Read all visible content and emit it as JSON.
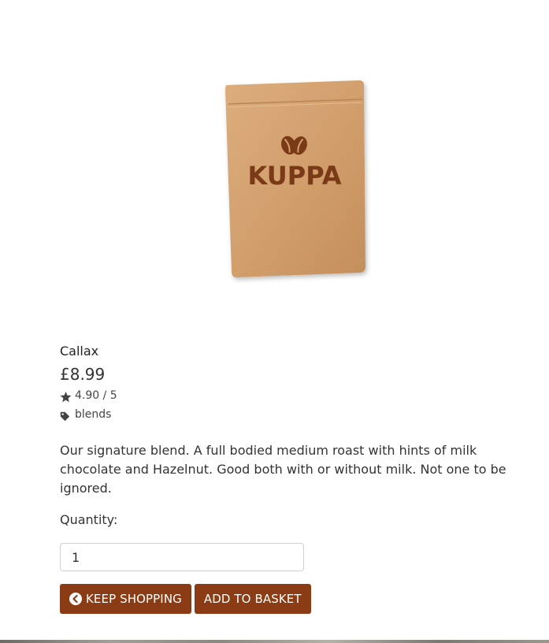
{
  "product": {
    "image_brand": "KUPPA",
    "name": "Callax",
    "price": "£8.99",
    "rating": "4.90 / 5",
    "tag": "blends",
    "description": "Our signature blend. A full bodied medium roast with hints of milk chocolate and Hazelnut. Good both with or without milk. Not one to be ignored."
  },
  "quantity": {
    "label": "Quantity:",
    "value": "1"
  },
  "buttons": {
    "keep_shopping": "KEEP SHOPPING",
    "add_to_basket": "ADD TO BASKET"
  },
  "colors": {
    "button_bg": "#8b3c14",
    "bag_kraft": "#d29f6d",
    "logo_brown": "#7a3a17"
  }
}
